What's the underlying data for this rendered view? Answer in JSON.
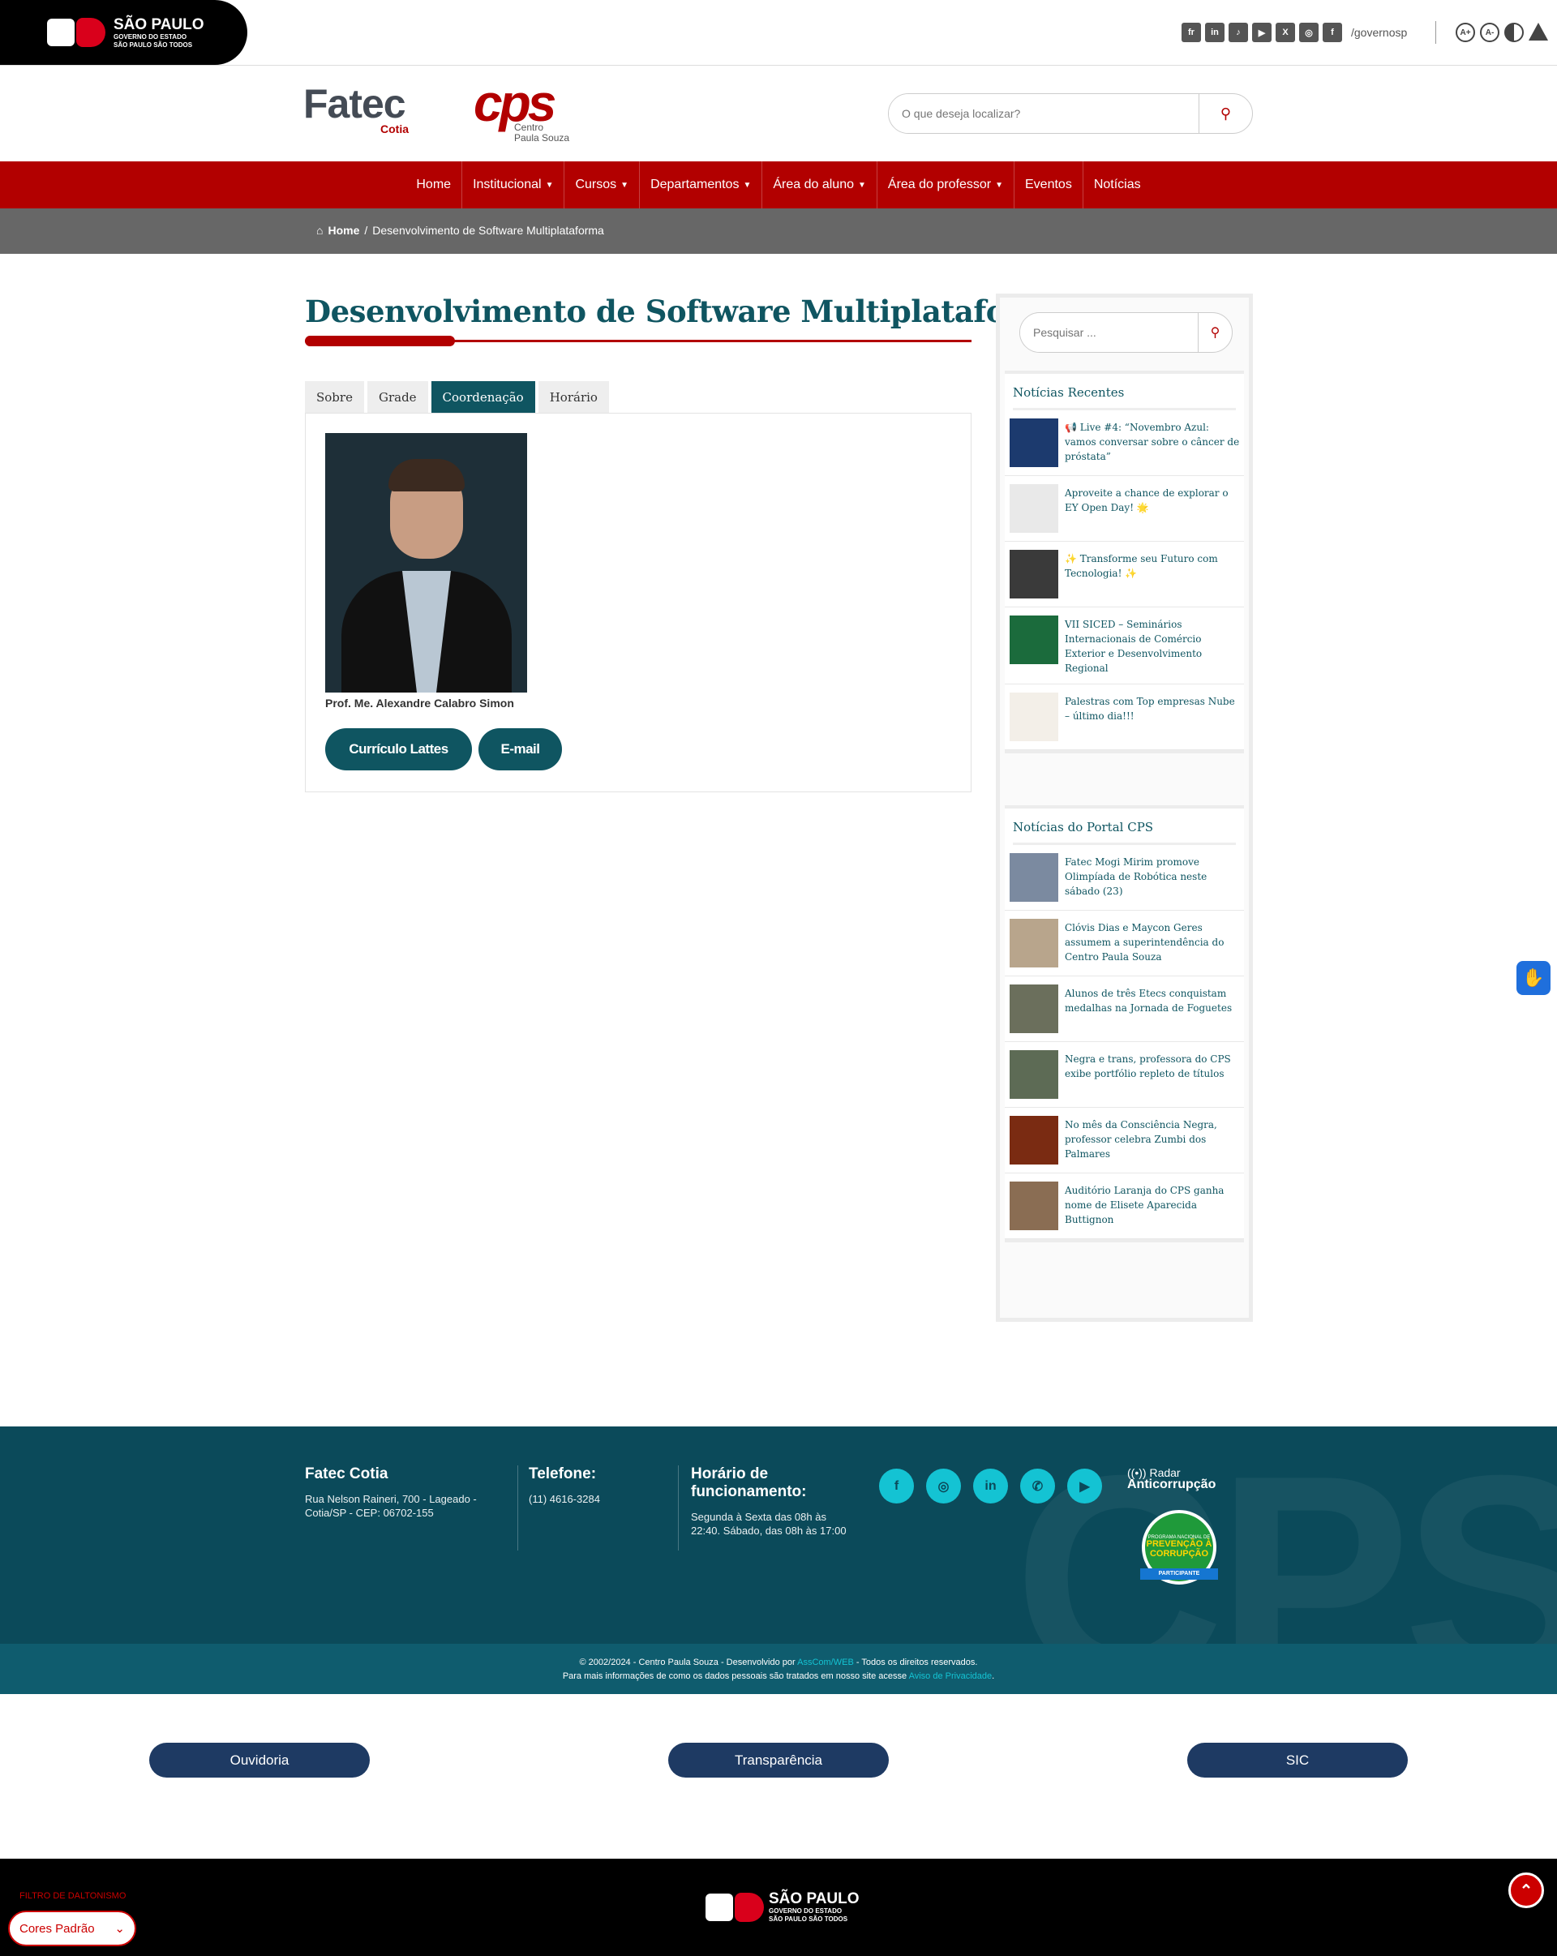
{
  "gov": {
    "title": "SÃO PAULO",
    "line1": "GOVERNO DO ESTADO",
    "line2": "SÃO PAULO SÃO TODOS",
    "social_handle": "/governosp",
    "social_icons": [
      "flickr-icon",
      "linkedin-icon",
      "tiktok-icon",
      "youtube-icon",
      "x-icon",
      "instagram-icon",
      "facebook-icon"
    ],
    "accessibility": [
      "A+",
      "A-"
    ]
  },
  "header": {
    "fatec_name": "Fatec",
    "fatec_city": "Cotia",
    "cps_letters": "CPS",
    "cps_sub1": "Centro",
    "cps_sub2": "Paula Souza",
    "search_placeholder": "O que deseja localizar?"
  },
  "nav": {
    "items": [
      {
        "label": "Home",
        "dropdown": false
      },
      {
        "label": "Institucional",
        "dropdown": true
      },
      {
        "label": "Cursos",
        "dropdown": true
      },
      {
        "label": "Departamentos",
        "dropdown": true
      },
      {
        "label": "Área do aluno",
        "dropdown": true
      },
      {
        "label": "Área do professor",
        "dropdown": true
      },
      {
        "label": "Eventos",
        "dropdown": false
      },
      {
        "label": "Notícias",
        "dropdown": false
      }
    ]
  },
  "breadcrumb": {
    "home": "Home",
    "sep": "/",
    "current": "Desenvolvimento de Software Multiplataforma"
  },
  "main": {
    "title": "Desenvolvimento de Software Multiplataforma",
    "tabs": [
      {
        "label": "Sobre",
        "active": false
      },
      {
        "label": "Grade",
        "active": false
      },
      {
        "label": "Coordenação",
        "active": true
      },
      {
        "label": "Horário",
        "active": false
      }
    ],
    "coordinator": "Prof. Me. Alexandre Calabro Simon",
    "btn_lattes": "Currículo Lattes",
    "btn_email": "E-mail"
  },
  "sidebar": {
    "search_placeholder": "Pesquisar ...",
    "recent_title": "Notícias Recentes",
    "recent": [
      {
        "title": "📢 Live #4: “Novembro Azul: vamos conversar sobre o câncer de próstata”",
        "thumb": "#1c3a6e"
      },
      {
        "title": "Aproveite a chance de explorar o EY Open Day! 🌟",
        "thumb": "#e9e9e9"
      },
      {
        "title": "✨ Transforme seu Futuro com Tecnologia! ✨",
        "thumb": "#3a3a3a"
      },
      {
        "title": "VII SICED – Seminários Internacionais de Comércio Exterior e Desenvolvimento Regional",
        "thumb": "#1b6b3c"
      },
      {
        "title": "Palestras com Top empresas Nube – último dia!!!",
        "thumb": "#f3efe8"
      }
    ],
    "portal_title": "Notícias do Portal CPS",
    "portal": [
      {
        "title": "Fatec Mogi Mirim promove Olimpíada de Robótica neste sábado (23)",
        "thumb": "#7b8aa0"
      },
      {
        "title": "Clóvis Dias e Maycon Geres assumem a superintendência do Centro Paula Souza",
        "thumb": "#b8a58c"
      },
      {
        "title": "Alunos de três Etecs conquistam medalhas na Jornada de Foguetes",
        "thumb": "#6b6f5c"
      },
      {
        "title": "Negra e trans, professora do CPS exibe portfólio repleto de títulos",
        "thumb": "#5d6b55"
      },
      {
        "title": "No mês da Consciência Negra, professor celebra Zumbi dos Palmares",
        "thumb": "#7a2b12"
      },
      {
        "title": "Auditório Laranja do CPS ganha nome de Elisete Aparecida Buttignon",
        "thumb": "#8a6d53"
      }
    ]
  },
  "footer": {
    "unit": "Fatec Cotia",
    "address": "Rua Nelson Raineri, 700 - Lageado - Cotia/SP - CEP: 06702-155",
    "phone_title": "Telefone:",
    "phone": "(11) 4616-3284",
    "hours_title": "Horário de funcionamento:",
    "hours": "Segunda à Sexta das 08h às 22:40. Sábado, das 08h às 17:00",
    "social": [
      "facebook-icon",
      "instagram-icon",
      "linkedin-icon",
      "whatsapp-icon",
      "youtube-icon"
    ],
    "radar1": "Radar",
    "radar2": "Anticorrupção",
    "seal_top": "PROGRAMA NACIONAL DE",
    "seal_main": "PREVENÇÃO À CORRUPÇÃO",
    "seal_ribbon": "PARTICIPANTE",
    "copy_pre": "© 2002/2024 - Centro Paula Souza - Desenvolvido por ",
    "copy_link": "AssCom/WEB",
    "copy_post": " - Todos os direitos reservados.",
    "privacy_pre": "Para mais informações de como os dados pessoais são tratados em nosso site acesse ",
    "privacy_link": "Aviso de Privacidade",
    "privacy_post": "."
  },
  "links": {
    "ouvidoria": "Ouvidoria",
    "transparencia": "Transparência",
    "sic": "SIC"
  },
  "bottom": {
    "filter_label": "FILTRO DE DALTONISMO",
    "filter_value": "Cores Padrão"
  }
}
